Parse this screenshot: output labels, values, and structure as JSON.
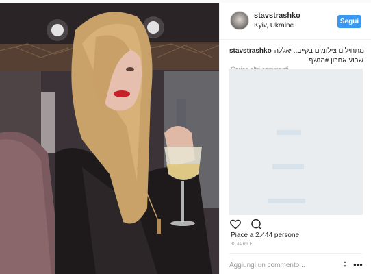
{
  "post": {
    "username": "stavstrashko",
    "location": "Kyiv, Ukraine",
    "follow_label": "Segui",
    "caption_line1": "מתחילים צילומים בקייב.. יאללה",
    "caption_line2": "שבוע אחרון #הנשף",
    "load_more": "Carica altri commenti",
    "likes": "Piace a 2.444 persone",
    "date": "30 APRILE",
    "comment_placeholder": "Aggiungi un commento...",
    "more_icon": "•••"
  },
  "icons": {
    "like": "heart-icon",
    "comment": "comment-icon",
    "options": "more-options-icon"
  },
  "colors": {
    "accent": "#3897f0",
    "muted": "#999999",
    "text": "#262626"
  }
}
